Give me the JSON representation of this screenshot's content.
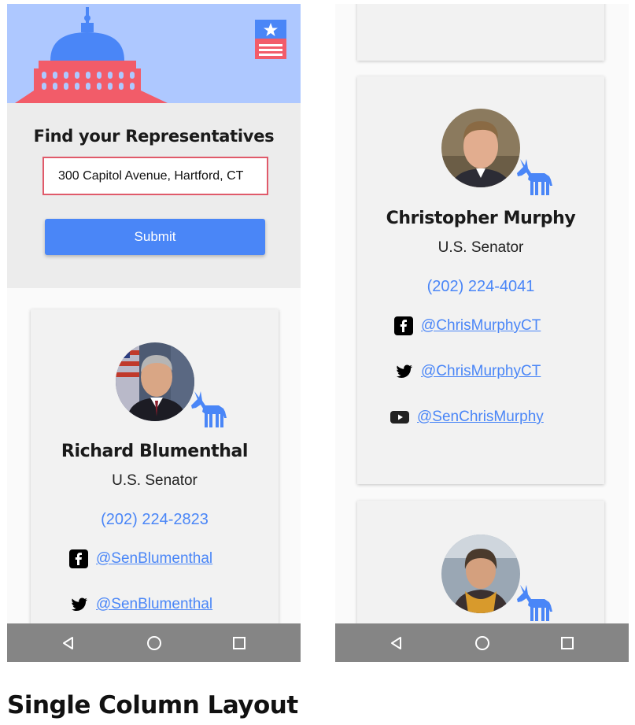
{
  "caption": "Single Column Layout",
  "colors": {
    "accent": "#4a86f7",
    "header_bg": "#aec8ff",
    "capitol_red": "#f25c69",
    "capitol_blue": "#4a86f7",
    "navbar": "#858585"
  },
  "search": {
    "title": "Find your Representatives",
    "address_value": "300 Capitol Avenue, Hartford, CT",
    "submit_label": "Submit"
  },
  "representatives": [
    {
      "name": "Richard Blumenthal",
      "office": "U.S. Senator",
      "phone": "(202) 224-2823",
      "party_icon": "democrat-donkey-icon",
      "social": [
        {
          "icon": "facebook-icon",
          "handle": "@SenBlumenthal"
        },
        {
          "icon": "twitter-icon",
          "handle": "@SenBlumenthal"
        }
      ]
    },
    {
      "name": "Christopher Murphy",
      "office": "U.S. Senator",
      "phone": "(202) 224-4041",
      "party_icon": "democrat-donkey-icon",
      "social": [
        {
          "icon": "facebook-icon",
          "handle": "@ChrisMurphyCT"
        },
        {
          "icon": "twitter-icon",
          "handle": "@ChrisMurphyCT"
        },
        {
          "icon": "youtube-icon",
          "handle": "@SenChrisMurphy"
        }
      ]
    },
    {
      "party_icon": "democrat-donkey-icon"
    }
  ],
  "navbar": {
    "icons": [
      "back-icon",
      "home-icon",
      "recents-icon"
    ]
  }
}
